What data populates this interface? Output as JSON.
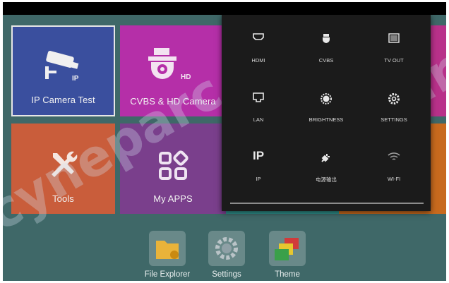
{
  "tiles": {
    "ip_camera": "IP Camera Test",
    "cvbs_hd": "CVBS & HD Camera",
    "tools": "Tools",
    "my_apps": "My APPS",
    "ip_badge": "IP",
    "hd_badge": "HD"
  },
  "quick_settings": {
    "items": [
      {
        "label": "HDMI",
        "icon": "hdmi-icon"
      },
      {
        "label": "CVBS",
        "icon": "cctv-camera-icon"
      },
      {
        "label": "TV OUT",
        "icon": "tv-out-icon"
      },
      {
        "label": "LAN",
        "icon": "lan-port-icon"
      },
      {
        "label": "BRIGHTNESS",
        "icon": "brightness-icon"
      },
      {
        "label": "SETTINGS",
        "icon": "gear-icon"
      },
      {
        "label": "IP",
        "icon": "ip-icon"
      },
      {
        "label": "电源输出",
        "icon": "power-plug-icon"
      },
      {
        "label": "WI-FI",
        "icon": "wifi-icon"
      }
    ],
    "ip_glyph": "IP"
  },
  "dock": {
    "file_explorer": "File Explorer",
    "settings": "Settings",
    "theme": "Theme"
  },
  "watermark": "cyneparc"
}
